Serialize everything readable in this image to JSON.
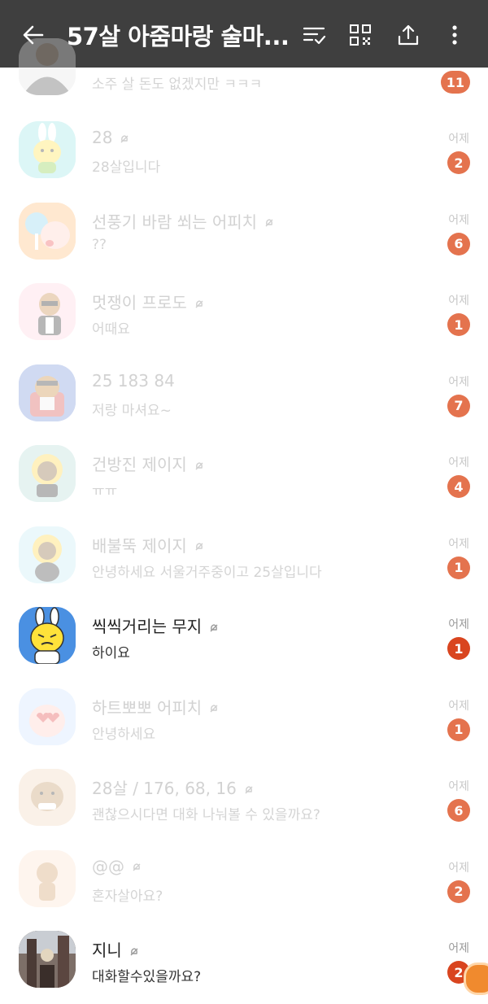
{
  "header": {
    "title": "57살 아줌마랑 술마...",
    "icons": [
      "back-arrow-icon",
      "sort-check-icon",
      "qr-code-icon",
      "share-icon",
      "more-vert-icon"
    ]
  },
  "colors": {
    "header_bg": "#3f3f3f",
    "badge": "#e4734e",
    "badge_active": "#d9451f"
  },
  "partial_row": {
    "message": "소주 살 돈도 없겠지만 ㅋㅋㅋ",
    "badge": "11"
  },
  "chats": [
    {
      "name": "28",
      "message": "28살입니다",
      "time": "어제",
      "badge": "2",
      "muted": true,
      "active": false,
      "avatar": "muzi-rabbit-avatar"
    },
    {
      "name": "선풍기 바람 쐬는 어피치",
      "message": "??",
      "time": "어제",
      "badge": "6",
      "muted": true,
      "active": false,
      "avatar": "apeach-fan-avatar"
    },
    {
      "name": "멋쟁이 프로도",
      "message": "어때요",
      "time": "어제",
      "badge": "1",
      "muted": true,
      "active": false,
      "avatar": "frodo-avatar"
    },
    {
      "name": "25 183 84",
      "message": "저랑 마셔요~",
      "time": "어제",
      "badge": "7",
      "muted": false,
      "active": false,
      "avatar": "ryan-chair-avatar"
    },
    {
      "name": "건방진 제이지",
      "message": "ㅠㅠ",
      "time": "어제",
      "badge": "4",
      "muted": true,
      "active": false,
      "avatar": "jayg-avatar"
    },
    {
      "name": "배불뚝 제이지",
      "message": "안녕하세요 서울거주중이고 25살입니다",
      "time": "어제",
      "badge": "1",
      "muted": true,
      "active": false,
      "avatar": "jayg-belly-avatar"
    },
    {
      "name": "씩씩거리는 무지",
      "message": "하이요",
      "time": "어제",
      "badge": "1",
      "muted": true,
      "active": true,
      "avatar": "muzi-angry-avatar"
    },
    {
      "name": "하트뽀뽀 어피치",
      "message": "안녕하세요",
      "time": "어제",
      "badge": "1",
      "muted": true,
      "active": false,
      "avatar": "apeach-heart-avatar"
    },
    {
      "name": "28살 / 176, 68, 16",
      "message": "괜찮으시다면 대화 나눠볼 수 있을까요?",
      "time": "어제",
      "badge": "6",
      "muted": true,
      "active": false,
      "avatar": "frodo-dog-avatar"
    },
    {
      "name": "@@",
      "message": "혼자살아요?",
      "time": "어제",
      "badge": "2",
      "muted": true,
      "active": false,
      "avatar": "frodo-small-avatar"
    },
    {
      "name": "지니",
      "message": "대화할수있을까요?",
      "time": "어제",
      "badge": "2",
      "muted": true,
      "active": true,
      "avatar": "photo-avatar"
    }
  ]
}
